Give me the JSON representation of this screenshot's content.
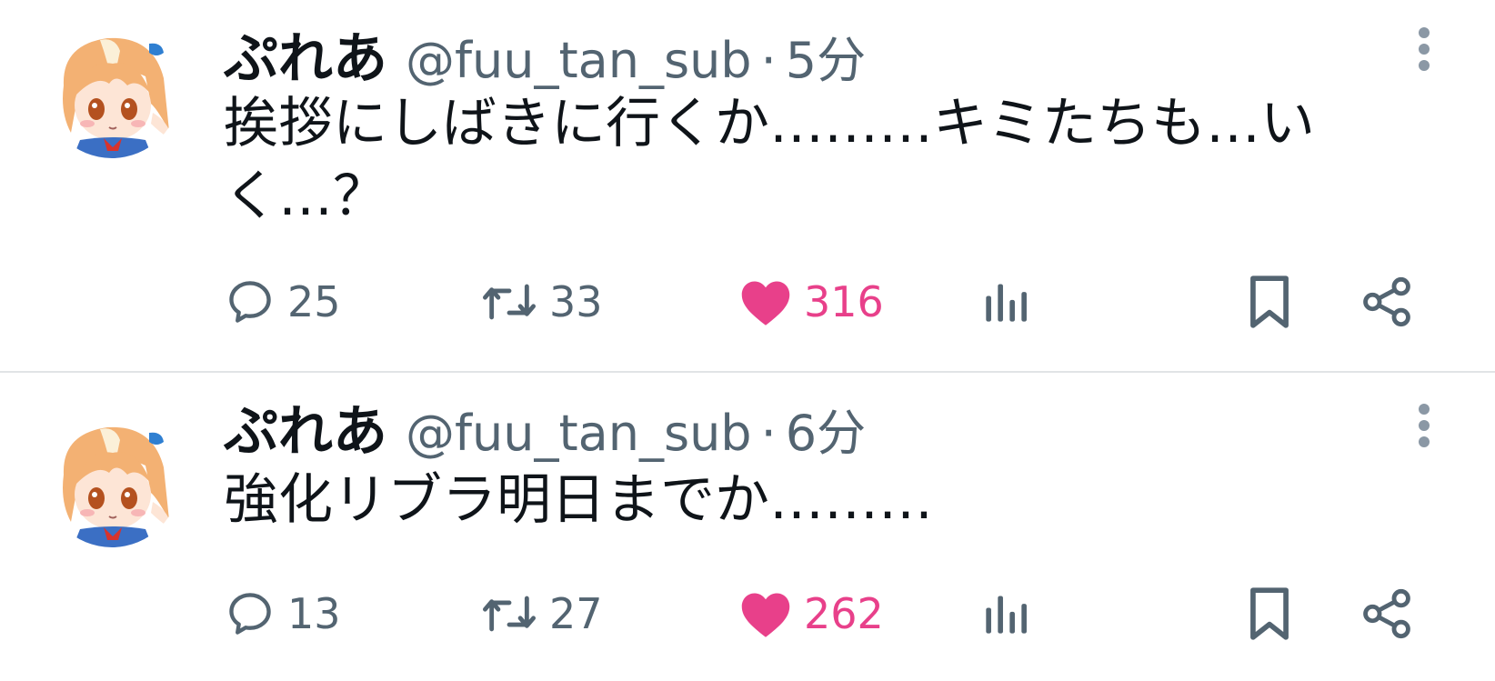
{
  "colors": {
    "text_primary": "#0f1419",
    "text_secondary": "#536471",
    "like_active": "#e8408a",
    "divider": "#e1e4e6"
  },
  "tweets": [
    {
      "display_name": "ぷれあ",
      "handle": "@fuu_tan_sub",
      "separator": "·",
      "time": "5分",
      "text": "挨拶にしばきに行くか………キミたちも…いく…？",
      "replies": "25",
      "retweets": "33",
      "likes": "316",
      "liked": true,
      "icons": [
        "reply-icon",
        "retweet-icon",
        "heart-icon",
        "views-icon",
        "bookmark-icon",
        "share-icon",
        "more-icon"
      ]
    },
    {
      "display_name": "ぷれあ",
      "handle": "@fuu_tan_sub",
      "separator": "·",
      "time": "6分",
      "text": "強化リブラ明日までか………",
      "replies": "13",
      "retweets": "27",
      "likes": "262",
      "liked": true,
      "icons": [
        "reply-icon",
        "retweet-icon",
        "heart-icon",
        "views-icon",
        "bookmark-icon",
        "share-icon",
        "more-icon"
      ]
    }
  ]
}
